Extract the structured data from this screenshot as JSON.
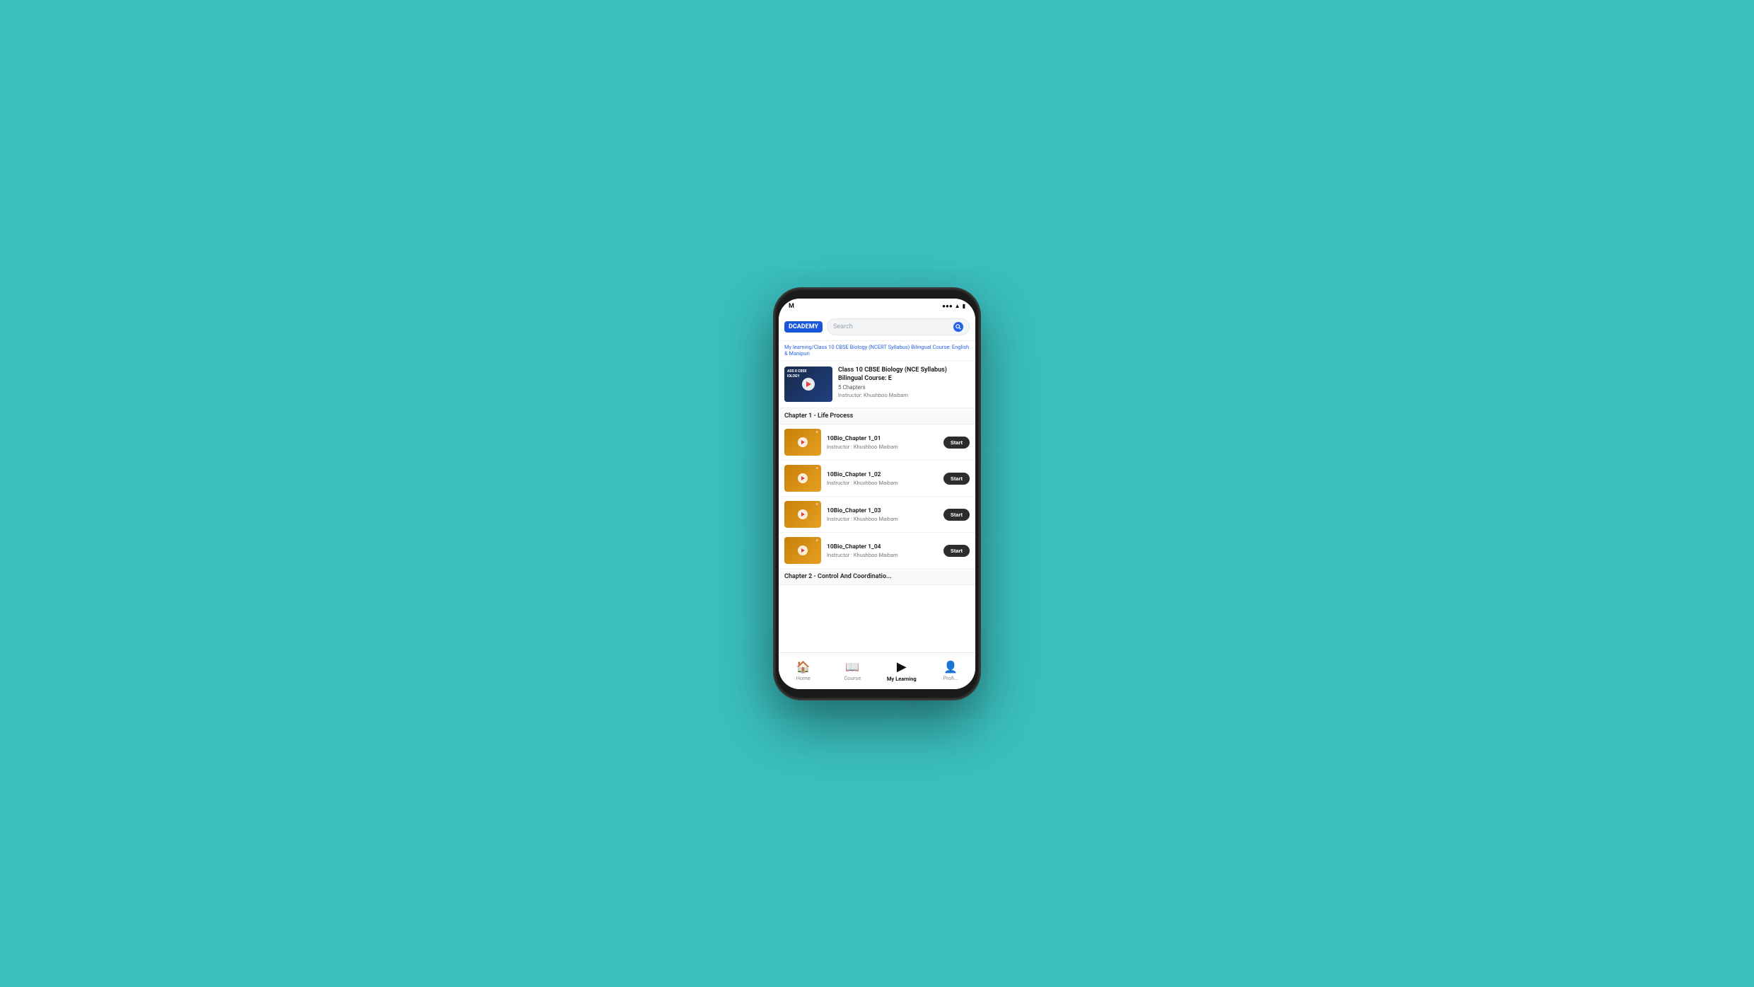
{
  "background": "#3bbfbf",
  "phone": {
    "statusBar": {
      "time": "M",
      "icons": "●●● 4G"
    },
    "header": {
      "logoText": "DCADEMY",
      "searchPlaceholder": "Search"
    },
    "breadcrumb": "My learning/Class 10 CBSE Biology (NCERT Syllabus) Bilingual Course: English & Manipuri",
    "courseCard": {
      "thumbnailLines": [
        "ASS X CBSE",
        "IOLOGY"
      ],
      "title": "Class 10 CBSE Biology (NCE Syllabus) Bilingual Course: E",
      "chapters": "5 Chapters",
      "instructor": "Instructor: Khushboo Maibam"
    },
    "chapter1": {
      "heading": "Chapter 1 - Life Process",
      "lessons": [
        {
          "title": "10Bio_Chapter 1_01",
          "instructor": "Instructor : Khushboo Maibam",
          "buttonLabel": "Start"
        },
        {
          "title": "10Bio_Chapter 1_02",
          "instructor": "Instructor : Khushboo Maibam",
          "buttonLabel": "Start"
        },
        {
          "title": "10Bio_Chapter 1_03",
          "instructor": "Instructor : Khushboo Maibam",
          "buttonLabel": "Start"
        },
        {
          "title": "10Bio_Chapter 1_04",
          "instructor": "Instructor : Khushboo Maibam",
          "buttonLabel": "Start"
        }
      ]
    },
    "chapter2Partial": "Chapter 2 - Control And Coordinatio...",
    "bottomNav": {
      "items": [
        {
          "icon": "🏠",
          "label": "Home",
          "active": false
        },
        {
          "icon": "📖",
          "label": "Course",
          "active": false
        },
        {
          "icon": "▶",
          "label": "My Learning",
          "active": true
        },
        {
          "icon": "👤",
          "label": "Profi...",
          "active": false
        }
      ]
    }
  }
}
